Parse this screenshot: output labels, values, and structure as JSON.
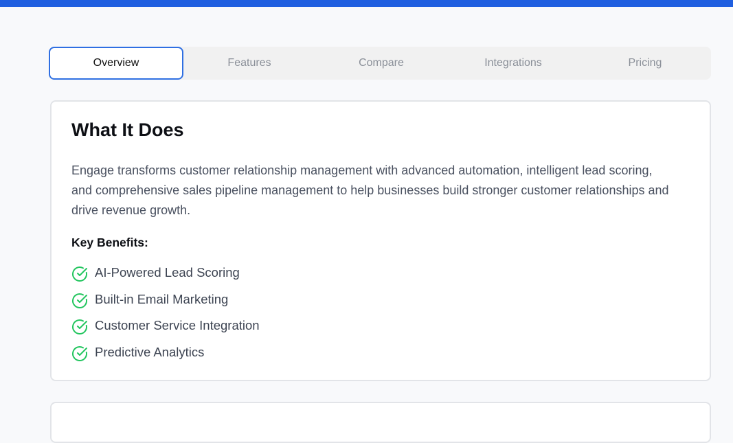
{
  "theme": {
    "accent": "#1f5fe0",
    "active_tab_border": "#2f6fe2",
    "check_color": "#22c55e"
  },
  "tabs": [
    {
      "label": "Overview",
      "active": true
    },
    {
      "label": "Features",
      "active": false
    },
    {
      "label": "Compare",
      "active": false
    },
    {
      "label": "Integrations",
      "active": false
    },
    {
      "label": "Pricing",
      "active": false
    }
  ],
  "overview": {
    "title": "What It Does",
    "description": "Engage transforms customer relationship management with advanced automation, intelligent lead scoring, and comprehensive sales pipeline management to help businesses build stronger customer relationships and drive revenue growth.",
    "benefits_heading": "Key Benefits:",
    "benefit_icon": "check-circle-icon",
    "benefits": [
      "AI-Powered Lead Scoring",
      "Built-in Email Marketing",
      "Customer Service Integration",
      "Predictive Analytics"
    ]
  }
}
